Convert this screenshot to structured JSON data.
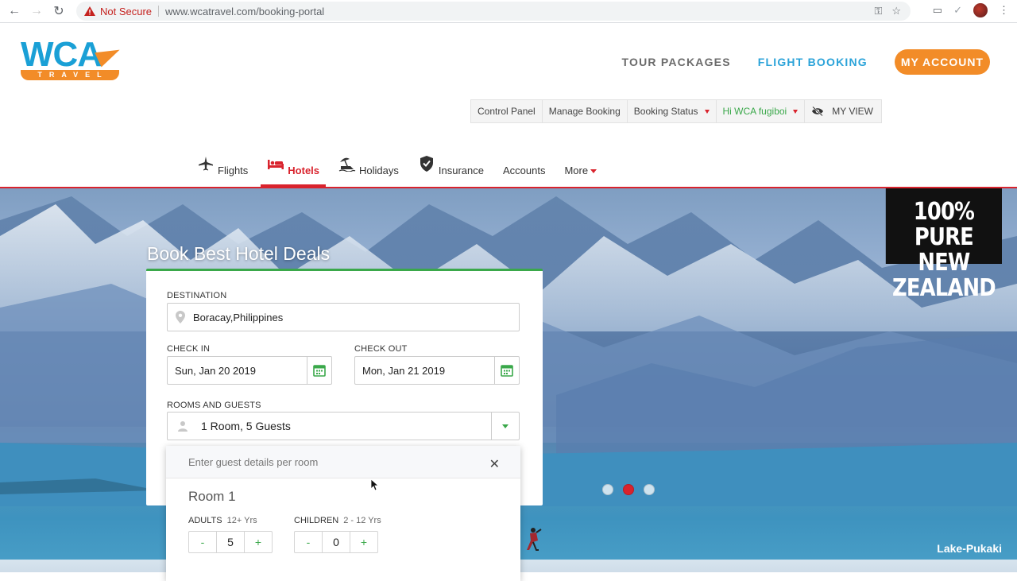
{
  "browser": {
    "security_label": "Not Secure",
    "url": "www.wcatravel.com/booking-portal"
  },
  "brand": {
    "logo_main": "WCA",
    "logo_sub": "TRAVEL",
    "accent_color": "#f28c28",
    "primary_color": "#1aa0d6",
    "active_color": "#d9232d"
  },
  "topnav": {
    "tour_packages": "TOUR PACKAGES",
    "flight_booking": "FLIGHT BOOKING",
    "my_account": "MY ACCOUNT"
  },
  "subbar": {
    "control_panel": "Control Panel",
    "manage_booking": "Manage Booking",
    "booking_status": "Booking Status",
    "greeting": "Hi WCA fugiboi",
    "my_view": "MY VIEW"
  },
  "mainnav": {
    "flights": "Flights",
    "hotels": "Hotels",
    "holidays": "Holidays",
    "insurance": "Insurance",
    "accounts": "Accounts",
    "more": "More"
  },
  "hero": {
    "badge_line1": "100% PURE",
    "badge_line2": "NEW ZEALAND",
    "location": "Lake-Pukaki",
    "slide_count": 3,
    "active_slide": 2
  },
  "booking": {
    "title": "Book Best Hotel Deals",
    "destination_label": "DESTINATION",
    "destination_value": "Boracay,Philippines",
    "checkin_label": "CHECK IN",
    "checkin_value": "Sun, Jan 20 2019",
    "checkout_label": "CHECK OUT",
    "checkout_value": "Mon, Jan 21 2019",
    "rooms_label": "ROOMS AND GUESTS",
    "rooms_value": "1 Room, 5 Guests"
  },
  "guest_panel": {
    "hint": "Enter guest details per room",
    "room_title": "Room 1",
    "adults_label": "ADULTS",
    "adults_sub": "12+ Yrs",
    "adults_value": "5",
    "children_label": "CHILDREN",
    "children_sub": "2 - 12 Yrs",
    "children_value": "0",
    "minus": "-",
    "plus": "+"
  }
}
